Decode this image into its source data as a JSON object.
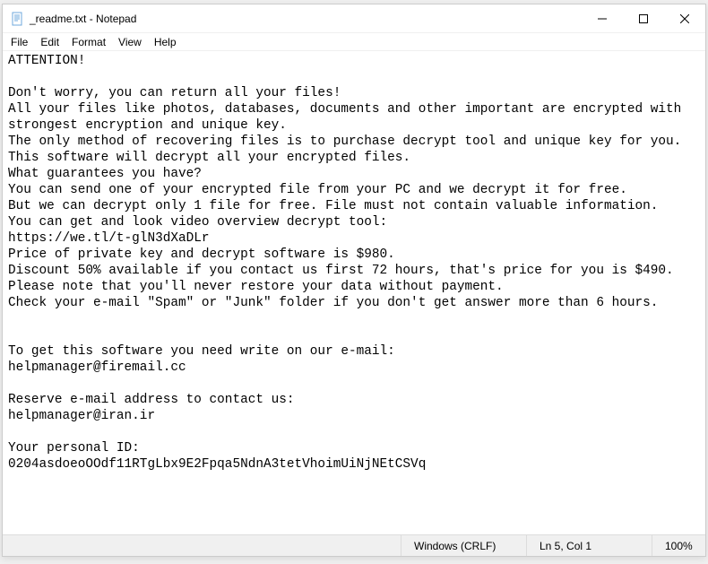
{
  "window": {
    "title": "_readme.txt - Notepad"
  },
  "menu": {
    "file": "File",
    "edit": "Edit",
    "format": "Format",
    "view": "View",
    "help": "Help"
  },
  "content": "ATTENTION!\n\nDon't worry, you can return all your files!\nAll your files like photos, databases, documents and other important are encrypted with strongest encryption and unique key.\nThe only method of recovering files is to purchase decrypt tool and unique key for you.\nThis software will decrypt all your encrypted files.\nWhat guarantees you have?\nYou can send one of your encrypted file from your PC and we decrypt it for free.\nBut we can decrypt only 1 file for free. File must not contain valuable information.\nYou can get and look video overview decrypt tool:\nhttps://we.tl/t-glN3dXaDLr\nPrice of private key and decrypt software is $980.\nDiscount 50% available if you contact us first 72 hours, that's price for you is $490.\nPlease note that you'll never restore your data without payment.\nCheck your e-mail \"Spam\" or \"Junk\" folder if you don't get answer more than 6 hours.\n\n\nTo get this software you need write on our e-mail:\nhelpmanager@firemail.cc\n\nReserve e-mail address to contact us:\nhelpmanager@iran.ir\n\nYour personal ID:\n0204asdoeoOOdf11RTgLbx9E2Fpqa5NdnA3tetVhoimUiNjNEtCSVq",
  "status": {
    "line_ending": "Windows (CRLF)",
    "position": "Ln 5, Col 1",
    "zoom": "100%"
  }
}
